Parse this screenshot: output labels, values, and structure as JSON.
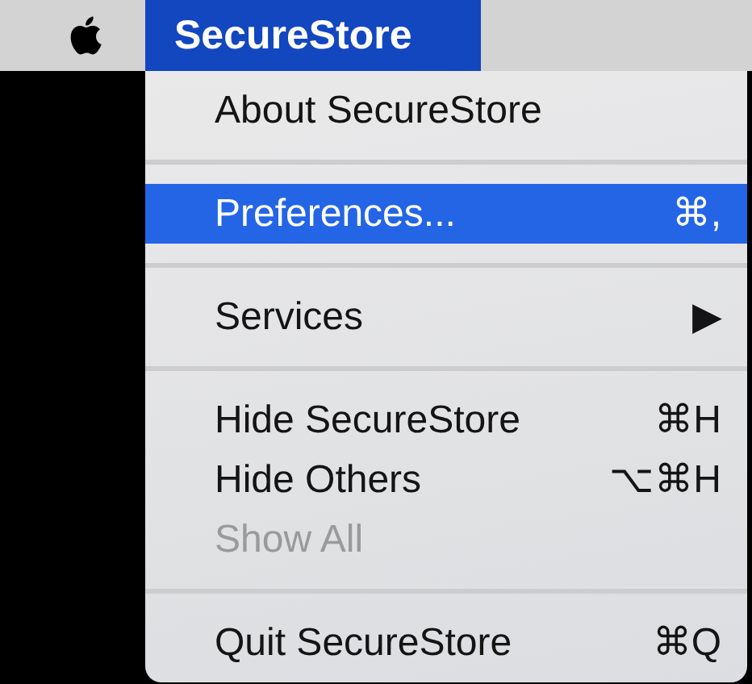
{
  "menu_bar": {
    "app_menu": {
      "label": "SecureStore",
      "selected": true
    }
  },
  "menu": {
    "items": [
      {
        "kind": "item",
        "label": "About SecureStore",
        "selected": false,
        "disabled": false
      },
      {
        "kind": "separator"
      },
      {
        "kind": "item",
        "label": "Preferences...",
        "shortcut": "⌘,",
        "selected": true,
        "disabled": false
      },
      {
        "kind": "separator"
      },
      {
        "kind": "item",
        "label": "Services",
        "submenu_arrow": "▶",
        "selected": false,
        "disabled": false
      },
      {
        "kind": "separator"
      },
      {
        "kind": "item",
        "label": "Hide SecureStore",
        "shortcut": "⌘H",
        "selected": false,
        "disabled": false
      },
      {
        "kind": "item",
        "label": "Hide Others",
        "shortcut": "⌥⌘H",
        "selected": false,
        "disabled": false
      },
      {
        "kind": "item",
        "label": "Show All",
        "selected": false,
        "disabled": true
      },
      {
        "kind": "separator"
      },
      {
        "kind": "item",
        "label": "Quit SecureStore",
        "shortcut": "⌘Q",
        "selected": false,
        "disabled": false
      }
    ]
  }
}
